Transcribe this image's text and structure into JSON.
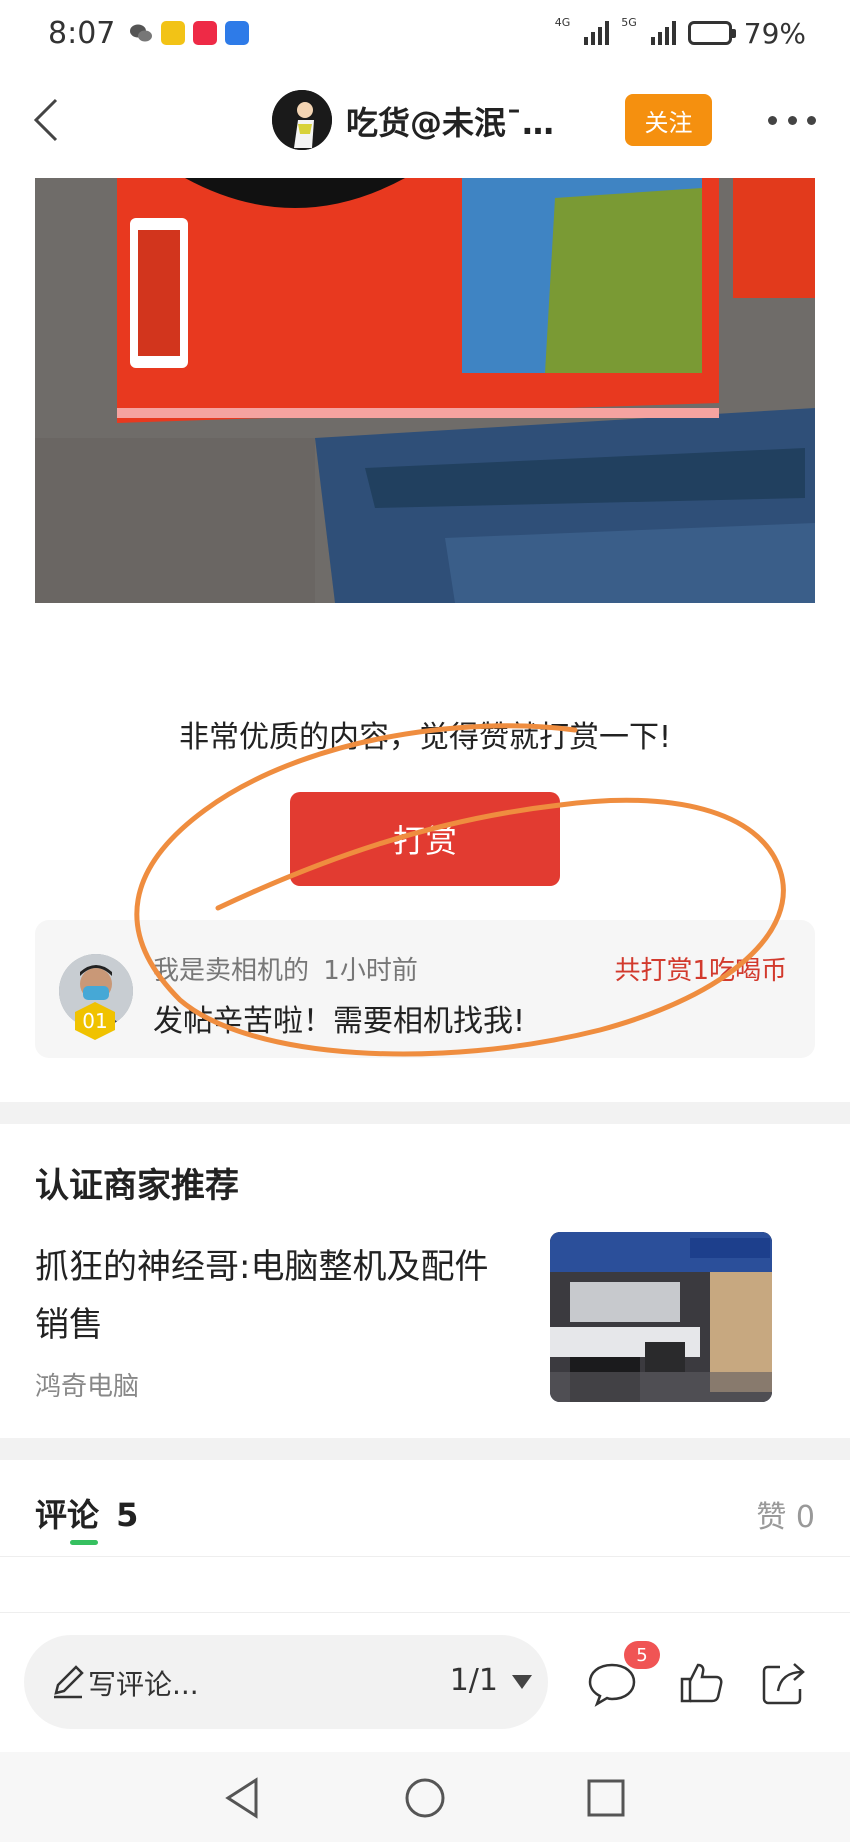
{
  "status_bar": {
    "time": "8:07",
    "network_1": "4G",
    "network_2": "5G",
    "battery": "79%",
    "battery_level": 0.79
  },
  "nav": {
    "title": "吃货@未泯ˉ…",
    "follow_label": "关注"
  },
  "reward": {
    "prompt": "非常优质的内容，觉得赞就打赏一下!",
    "button_label": "打赏",
    "tipper_name": "我是卖相机的",
    "tipper_time": "1小时前",
    "amount": "共打赏1吃喝币",
    "message": "发帖辛苦啦！需要相机找我!",
    "rank": "01"
  },
  "merchant": {
    "section_title": "认证商家推荐",
    "title": "抓狂的神经哥:电脑整机及配件销售",
    "shop_name": "鸿奇电脑"
  },
  "comments": {
    "label": "评论",
    "count": "5",
    "likes": "赞 0"
  },
  "toolbar": {
    "placeholder": "写评论...",
    "page": "1/1",
    "comment_badge": "5"
  },
  "colors": {
    "follow": "#f5900f",
    "reward_button": "#e23b31",
    "tip_amount": "#d23a2d",
    "annotation": "#ef8d3f",
    "comments_underline": "#36c060"
  },
  "icons": [
    "back-arrow-icon",
    "more-dots-icon",
    "pencil-icon",
    "caret-down-icon",
    "comment-bubble-icon",
    "thumbs-up-icon",
    "share-icon",
    "nav-back-icon",
    "nav-home-icon",
    "nav-recents-icon"
  ]
}
